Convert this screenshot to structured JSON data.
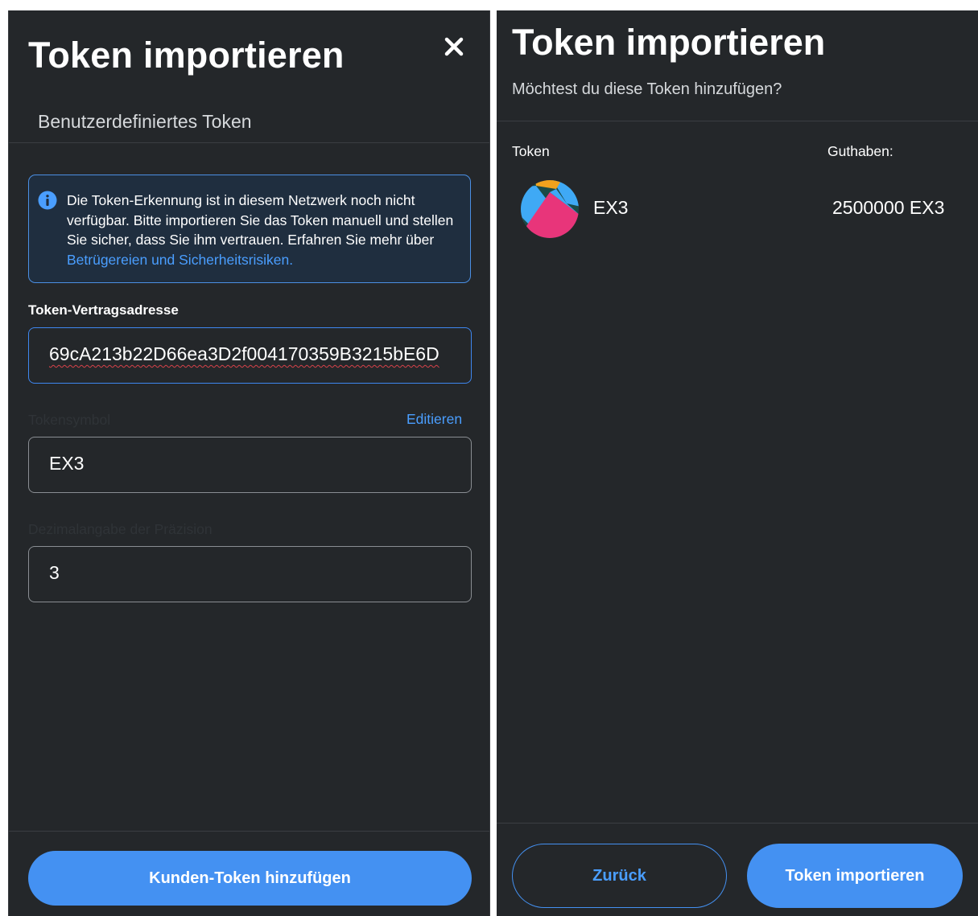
{
  "left": {
    "title": "Token importieren",
    "close_icon": "close-icon",
    "tab_label": "Benutzerdefiniertes Token",
    "notice": {
      "icon": "info-icon",
      "text": "Die Token-Erkennung ist in diesem Netzwerk noch nicht verfügbar. Bitte importieren Sie das Token manuell und stellen Sie sicher, dass Sie ihm vertrauen. Erfahren Sie mehr über ",
      "link": "Betrügereien und Sicherheitsrisiken."
    },
    "address": {
      "label": "Token-Vertragsadresse",
      "value": "69cA213b22D66ea3D2f004170359B3215bE6D"
    },
    "symbol": {
      "label": "Tokensymbol",
      "edit_label": "Editieren",
      "value": "EX3"
    },
    "decimals": {
      "label": "Dezimalangabe der Präzision",
      "value": "3"
    },
    "add_button": "Kunden-Token hinzufügen"
  },
  "right": {
    "title": "Token importieren",
    "subtitle": "Möchtest du diese Token hinzufügen?",
    "col_token": "Token",
    "col_balance": "Guthaben:",
    "token": {
      "name": "EX3",
      "balance": "2500000 EX3",
      "avatar_colors": [
        "#e8357a",
        "#3fa9f5",
        "#f0a21d",
        "#1b4a46"
      ]
    },
    "back_button": "Zurück",
    "import_button": "Token importieren"
  },
  "colors": {
    "background": "#24272a",
    "primary": "#4491f2",
    "link": "#4a9eff",
    "notice_border": "#4b8fe3",
    "error_underline": "#d8424a"
  }
}
